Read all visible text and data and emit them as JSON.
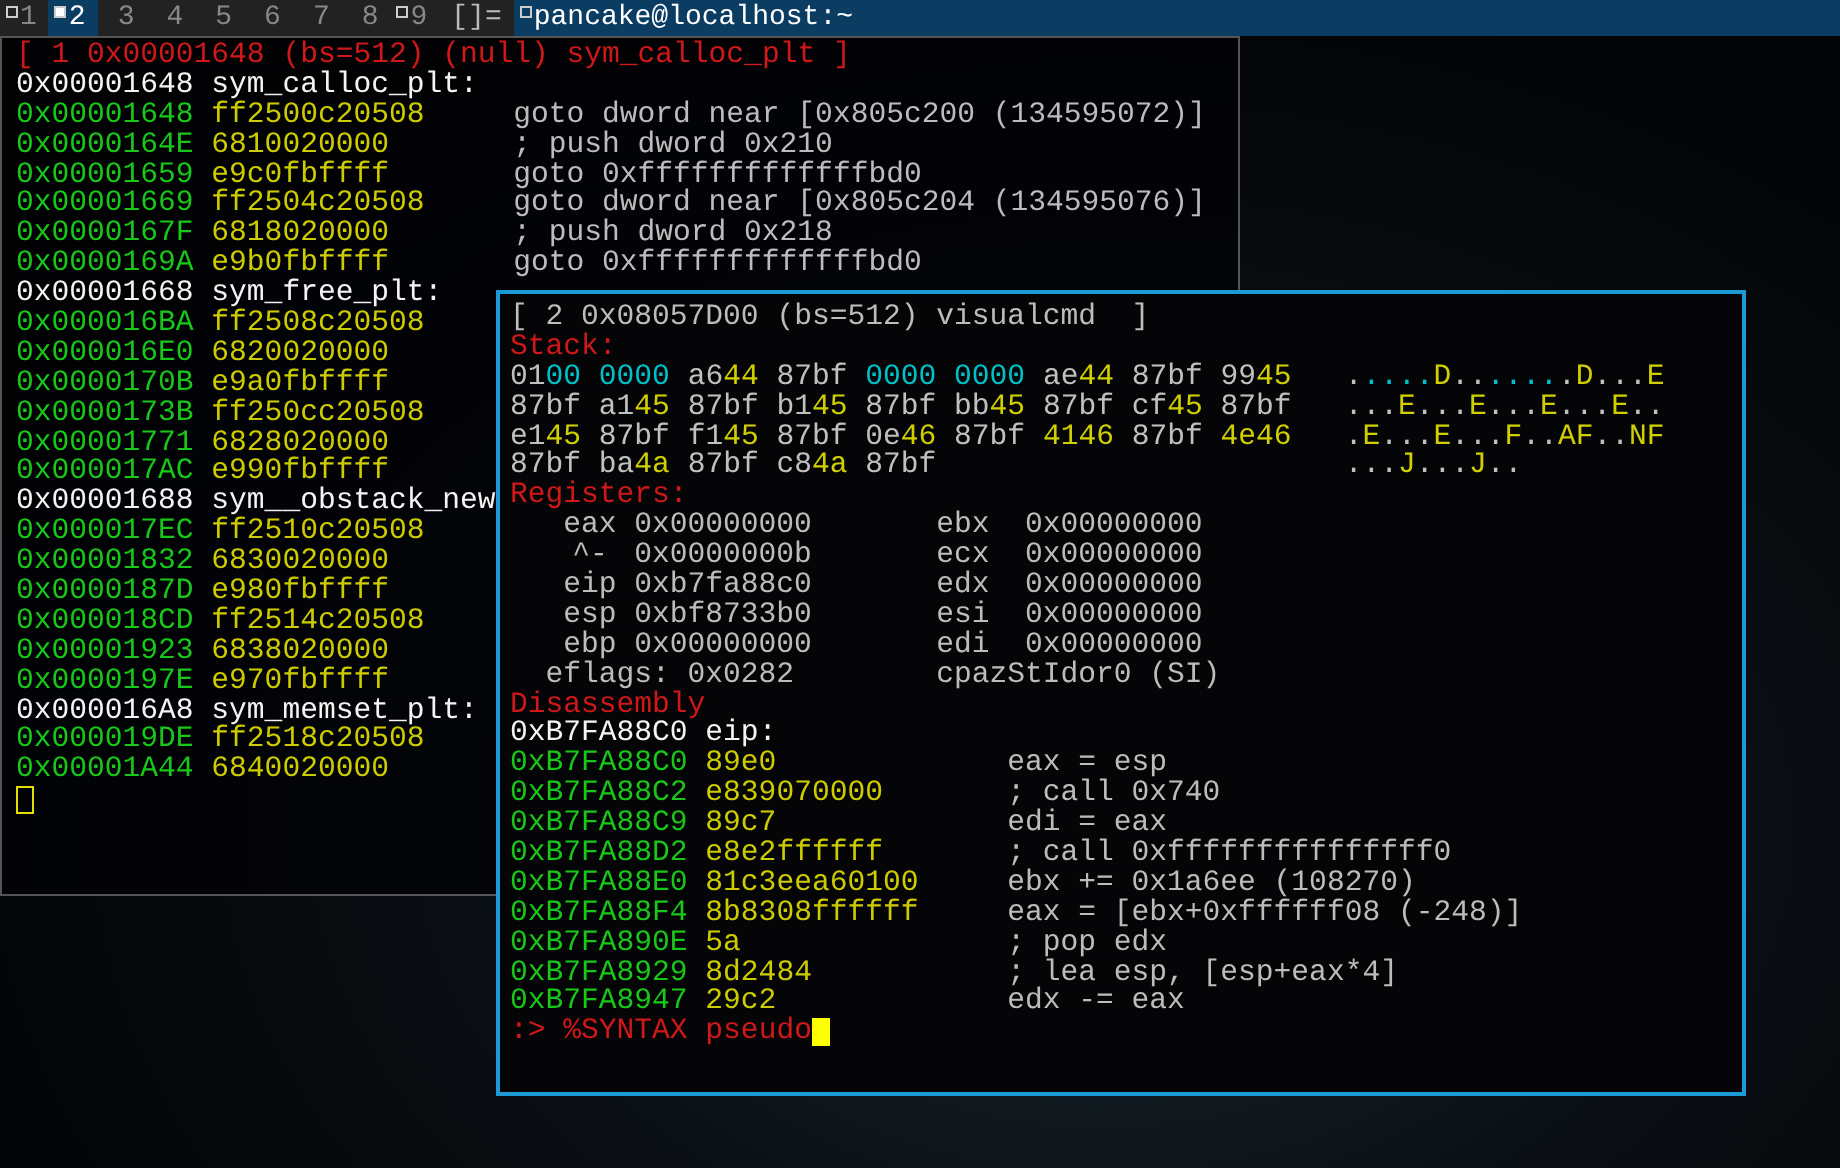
{
  "topbar": {
    "tags": [
      {
        "label": "1",
        "selected": false,
        "occupied": true
      },
      {
        "label": "2",
        "selected": true,
        "occupied": true
      },
      {
        "label": "3",
        "selected": false,
        "occupied": false
      },
      {
        "label": "4",
        "selected": false,
        "occupied": false
      },
      {
        "label": "5",
        "selected": false,
        "occupied": false
      },
      {
        "label": "6",
        "selected": false,
        "occupied": false
      },
      {
        "label": "7",
        "selected": false,
        "occupied": false
      },
      {
        "label": "8",
        "selected": false,
        "occupied": false
      },
      {
        "label": "9",
        "selected": false,
        "occupied": true
      }
    ],
    "layout": "[]=",
    "title": "pancake@localhost:~"
  },
  "terminal_1": {
    "header": "[ 1 0x00001648 (bs=512) (null) sym_calloc_plt ]",
    "lines": [
      {
        "kind": "label",
        "address": "0x00001648",
        "symbol": "sym_calloc_plt:"
      },
      {
        "kind": "code",
        "address": "0x00001648",
        "bytes": "ff2500c20508",
        "asm": "goto dword near [0x805c200 (134595072)]"
      },
      {
        "kind": "code",
        "address": "0x0000164E",
        "bytes": "6810020000",
        "asm": "; push dword 0x210"
      },
      {
        "kind": "code",
        "address": "0x00001659",
        "bytes": "e9c0fbffff",
        "asm": "goto 0xfffffffffffffbd0"
      },
      {
        "kind": "code",
        "address": "0x00001669",
        "bytes": "ff2504c20508",
        "asm": "goto dword near [0x805c204 (134595076)]"
      },
      {
        "kind": "code",
        "address": "0x0000167F",
        "bytes": "6818020000",
        "asm": "; push dword 0x218"
      },
      {
        "kind": "code",
        "address": "0x0000169A",
        "bytes": "e9b0fbffff",
        "asm": "goto 0xfffffffffffffbd0"
      },
      {
        "kind": "label",
        "address": "0x00001668",
        "symbol": "sym_free_plt:"
      },
      {
        "kind": "code",
        "address": "0x000016BA",
        "bytes": "ff2508c20508"
      },
      {
        "kind": "code",
        "address": "0x000016E0",
        "bytes": "6820020000"
      },
      {
        "kind": "code",
        "address": "0x0000170B",
        "bytes": "e9a0fbffff"
      },
      {
        "kind": "code",
        "address": "0x0000173B",
        "bytes": "ff250cc20508"
      },
      {
        "kind": "code",
        "address": "0x00001771",
        "bytes": "6828020000"
      },
      {
        "kind": "code",
        "address": "0x000017AC",
        "bytes": "e990fbffff"
      },
      {
        "kind": "label",
        "address": "0x00001688",
        "symbol": "sym__obstack_new"
      },
      {
        "kind": "code",
        "address": "0x000017EC",
        "bytes": "ff2510c20508"
      },
      {
        "kind": "code",
        "address": "0x00001832",
        "bytes": "6830020000"
      },
      {
        "kind": "code",
        "address": "0x0000187D",
        "bytes": "e980fbffff"
      },
      {
        "kind": "code",
        "address": "0x000018CD",
        "bytes": "ff2514c20508"
      },
      {
        "kind": "code",
        "address": "0x00001923",
        "bytes": "6838020000"
      },
      {
        "kind": "code",
        "address": "0x0000197E",
        "bytes": "e970fbffff"
      },
      {
        "kind": "label",
        "address": "0x000016A8",
        "symbol": "sym_memset_plt:"
      },
      {
        "kind": "code",
        "address": "0x000019DE",
        "bytes": "ff2518c20508"
      },
      {
        "kind": "code",
        "address": "0x00001A44",
        "bytes": "6840020000"
      }
    ]
  },
  "terminal_2": {
    "header": "[ 2 0x08057D00 (bs=512) visualcmd  ]",
    "stack_heading": "Stack:",
    "stack_rows": [
      {
        "words": [
          {
            "parts": [
              {
                "text": "01",
                "color": "#c0c0c0"
              },
              {
                "text": "00",
                "color": "#00c0c8"
              }
            ]
          },
          {
            "parts": [
              {
                "text": "0000",
                "color": "#00c0c8"
              }
            ]
          },
          {
            "parts": [
              {
                "text": "a6",
                "color": "#c0c0c0"
              },
              {
                "text": "44",
                "color": "#d0d000"
              }
            ]
          },
          {
            "parts": [
              {
                "text": "87bf",
                "color": "#c0c0c0"
              }
            ]
          },
          {
            "parts": [
              {
                "text": "0000",
                "color": "#00c0c8"
              }
            ]
          },
          {
            "parts": [
              {
                "text": "0000",
                "color": "#00c0c8"
              }
            ]
          },
          {
            "parts": [
              {
                "text": "ae",
                "color": "#c0c0c0"
              },
              {
                "text": "44",
                "color": "#d0d000"
              }
            ]
          },
          {
            "parts": [
              {
                "text": "87bf",
                "color": "#c0c0c0"
              }
            ]
          },
          {
            "parts": [
              {
                "text": "99",
                "color": "#c0c0c0"
              },
              {
                "text": "45",
                "color": "#d0d000"
              }
            ]
          }
        ],
        "ascii": [
          {
            "text": ".",
            "color": "#c0c0c0"
          },
          {
            "text": "....",
            "color": "#00c0c8"
          },
          {
            "text": "D",
            "color": "#d0d000"
          },
          {
            "text": "..",
            "color": "#c0c0c0"
          },
          {
            "text": "....",
            "color": "#00c0c8"
          },
          {
            "text": ".",
            "color": "#c0c0c0"
          },
          {
            "text": "D",
            "color": "#d0d000"
          },
          {
            "text": "..",
            "color": "#c0c0c0"
          },
          {
            "text": ".",
            "color": "#c0c0c0"
          },
          {
            "text": "E",
            "color": "#d0d000"
          }
        ]
      },
      {
        "words": [
          {
            "parts": [
              {
                "text": "87bf",
                "color": "#c0c0c0"
              }
            ]
          },
          {
            "parts": [
              {
                "text": "a1",
                "color": "#c0c0c0"
              },
              {
                "text": "45",
                "color": "#d0d000"
              }
            ]
          },
          {
            "parts": [
              {
                "text": "87bf",
                "color": "#c0c0c0"
              }
            ]
          },
          {
            "parts": [
              {
                "text": "b1",
                "color": "#c0c0c0"
              },
              {
                "text": "45",
                "color": "#d0d000"
              }
            ]
          },
          {
            "parts": [
              {
                "text": "87bf",
                "color": "#c0c0c0"
              }
            ]
          },
          {
            "parts": [
              {
                "text": "bb",
                "color": "#c0c0c0"
              },
              {
                "text": "45",
                "color": "#d0d000"
              }
            ]
          },
          {
            "parts": [
              {
                "text": "87bf",
                "color": "#c0c0c0"
              }
            ]
          },
          {
            "parts": [
              {
                "text": "cf",
                "color": "#c0c0c0"
              },
              {
                "text": "45",
                "color": "#d0d000"
              }
            ]
          },
          {
            "parts": [
              {
                "text": "87bf",
                "color": "#c0c0c0"
              }
            ]
          }
        ],
        "ascii": [
          {
            "text": "...",
            "color": "#c0c0c0"
          },
          {
            "text": "E",
            "color": "#d0d000"
          },
          {
            "text": "...",
            "color": "#c0c0c0"
          },
          {
            "text": "E",
            "color": "#d0d000"
          },
          {
            "text": "...",
            "color": "#c0c0c0"
          },
          {
            "text": "E",
            "color": "#d0d000"
          },
          {
            "text": "...",
            "color": "#c0c0c0"
          },
          {
            "text": "E",
            "color": "#d0d000"
          },
          {
            "text": "..",
            "color": "#c0c0c0"
          }
        ]
      },
      {
        "words": [
          {
            "parts": [
              {
                "text": "e1",
                "color": "#c0c0c0"
              },
              {
                "text": "45",
                "color": "#d0d000"
              }
            ]
          },
          {
            "parts": [
              {
                "text": "87bf",
                "color": "#c0c0c0"
              }
            ]
          },
          {
            "parts": [
              {
                "text": "f1",
                "color": "#c0c0c0"
              },
              {
                "text": "45",
                "color": "#d0d000"
              }
            ]
          },
          {
            "parts": [
              {
                "text": "87bf",
                "color": "#c0c0c0"
              }
            ]
          },
          {
            "parts": [
              {
                "text": "0e",
                "color": "#c0c0c0"
              },
              {
                "text": "46",
                "color": "#d0d000"
              }
            ]
          },
          {
            "parts": [
              {
                "text": "87bf",
                "color": "#c0c0c0"
              }
            ]
          },
          {
            "parts": [
              {
                "text": "4146",
                "color": "#d0d000"
              }
            ]
          },
          {
            "parts": [
              {
                "text": "87bf",
                "color": "#c0c0c0"
              }
            ]
          },
          {
            "parts": [
              {
                "text": "4e46",
                "color": "#d0d000"
              }
            ]
          }
        ],
        "ascii": [
          {
            "text": ".",
            "color": "#c0c0c0"
          },
          {
            "text": "E",
            "color": "#d0d000"
          },
          {
            "text": "...",
            "color": "#c0c0c0"
          },
          {
            "text": "E",
            "color": "#d0d000"
          },
          {
            "text": "...",
            "color": "#c0c0c0"
          },
          {
            "text": "F",
            "color": "#d0d000"
          },
          {
            "text": "..",
            "color": "#c0c0c0"
          },
          {
            "text": "AF",
            "color": "#d0d000"
          },
          {
            "text": "..",
            "color": "#c0c0c0"
          },
          {
            "text": "NF",
            "color": "#d0d000"
          }
        ]
      },
      {
        "words": [
          {
            "parts": [
              {
                "text": "87bf",
                "color": "#c0c0c0"
              }
            ]
          },
          {
            "parts": [
              {
                "text": "ba",
                "color": "#c0c0c0"
              },
              {
                "text": "4a",
                "color": "#d0d000"
              }
            ]
          },
          {
            "parts": [
              {
                "text": "87bf",
                "color": "#c0c0c0"
              }
            ]
          },
          {
            "parts": [
              {
                "text": "c8",
                "color": "#c0c0c0"
              },
              {
                "text": "4a",
                "color": "#d0d000"
              }
            ]
          },
          {
            "parts": [
              {
                "text": "87bf",
                "color": "#c0c0c0"
              }
            ]
          }
        ],
        "ascii": [
          {
            "text": "...",
            "color": "#c0c0c0"
          },
          {
            "text": "J",
            "color": "#d0d000"
          },
          {
            "text": "...",
            "color": "#c0c0c0"
          },
          {
            "text": "J",
            "color": "#d0d000"
          },
          {
            "text": "..",
            "color": "#c0c0c0"
          }
        ]
      }
    ],
    "registers_heading": "Registers:",
    "registers": [
      {
        "left_name": "eax",
        "left_value": "0x00000000",
        "right_name": "ebx",
        "right_value": "0x00000000"
      },
      {
        "left_name": "^-",
        "left_value": "0x0000000b",
        "right_name": "ecx",
        "right_value": "0x00000000"
      },
      {
        "left_name": "eip",
        "left_value": "0xb7fa88c0",
        "right_name": "edx",
        "right_value": "0x00000000"
      },
      {
        "left_name": "esp",
        "left_value": "0xbf8733b0",
        "right_name": "esi",
        "right_value": "0x00000000"
      },
      {
        "left_name": "ebp",
        "left_value": "0x00000000",
        "right_name": "edi",
        "right_value": "0x00000000"
      }
    ],
    "eflags": "eflags: 0x0282",
    "flags": "cpazStIdor0 (SI)",
    "disassembly_heading": "Disassembly",
    "eip_label": "0xB7FA88C0 eip:",
    "disassembly": [
      {
        "address": "0xB7FA88C0",
        "bytes": "89e0",
        "asm": "eax = esp"
      },
      {
        "address": "0xB7FA88C2",
        "bytes": "e839070000",
        "asm": "; call 0x740"
      },
      {
        "address": "0xB7FA88C9",
        "bytes": "89c7",
        "asm": "edi = eax"
      },
      {
        "address": "0xB7FA88D2",
        "bytes": "e8e2ffffff",
        "asm": "; call 0xfffffffffffffff0"
      },
      {
        "address": "0xB7FA88E0",
        "bytes": "81c3eea60100",
        "asm": "ebx += 0x1a6ee (108270)"
      },
      {
        "address": "0xB7FA88F4",
        "bytes": "8b8308ffffff",
        "asm": "eax = [ebx+0xffffff08 (-248)]"
      },
      {
        "address": "0xB7FA890E",
        "bytes": "5a",
        "asm": "; pop edx"
      },
      {
        "address": "0xB7FA8929",
        "bytes": "8d2484",
        "asm": "; lea esp, [esp+eax*4]"
      },
      {
        "address": "0xB7FA8947",
        "bytes": "29c2",
        "asm": "edx -= eax"
      }
    ],
    "prompt": ":>",
    "command": "%SYNTAX pseudo"
  }
}
